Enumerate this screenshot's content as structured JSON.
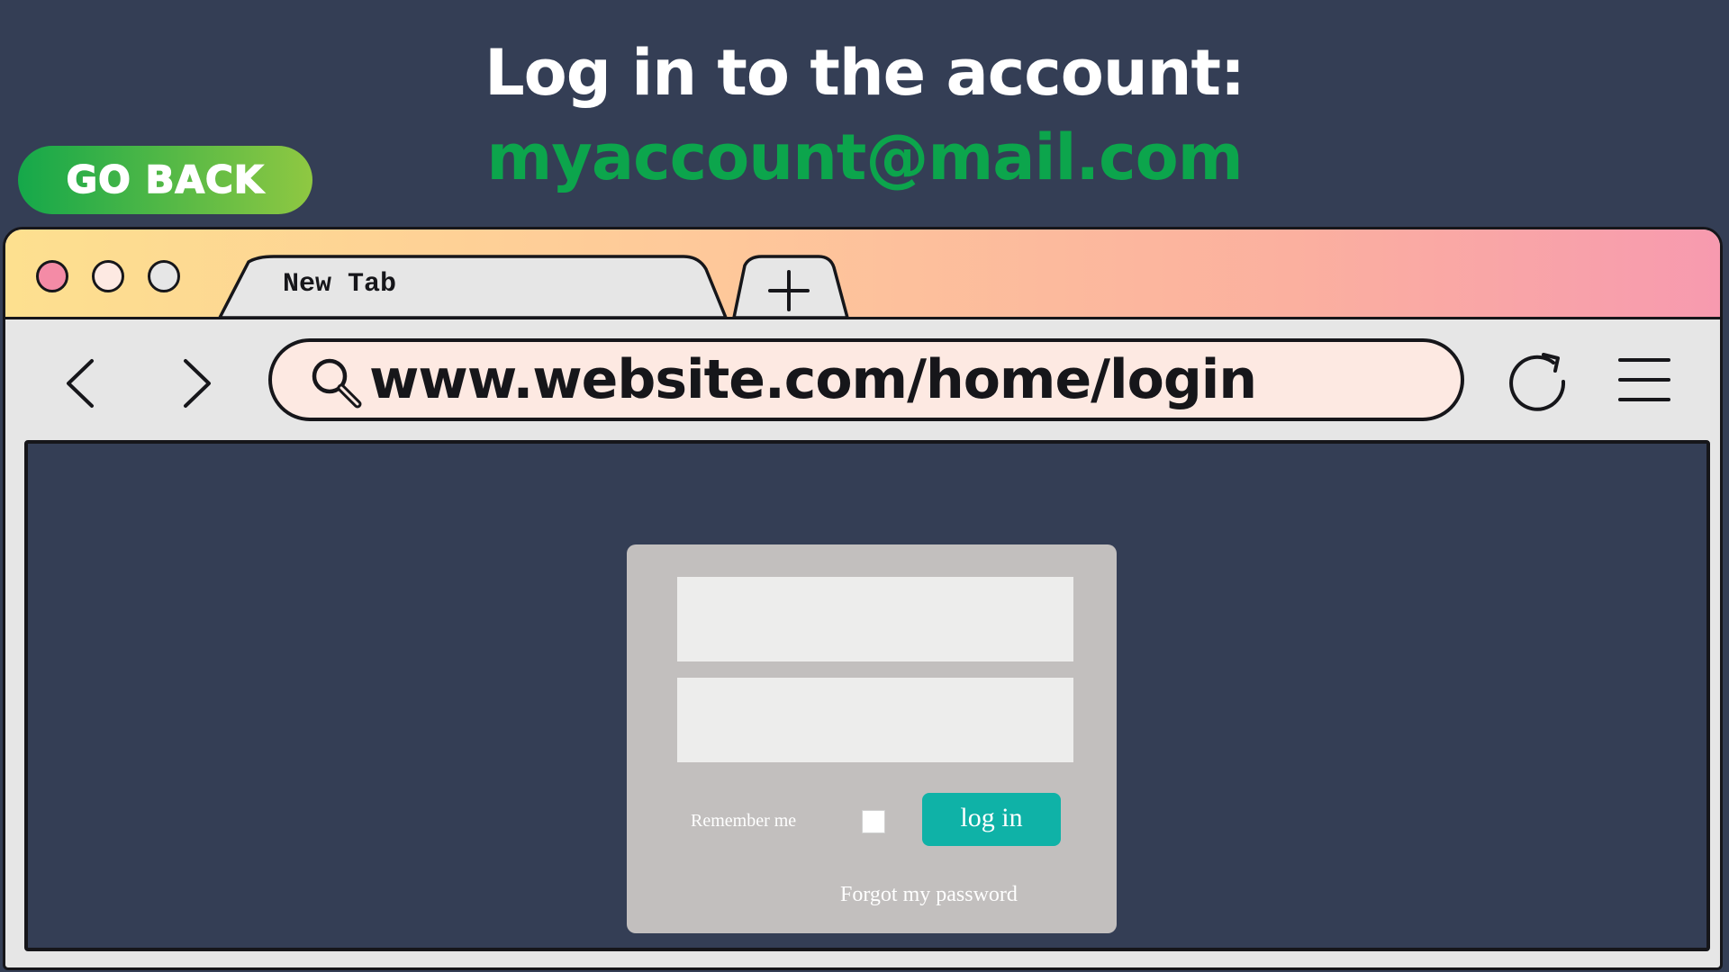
{
  "header": {
    "instruction": "Log in to the account:",
    "account_email": "myaccount@mail.com",
    "go_back_label": "GO BACK"
  },
  "browser": {
    "window_controls": [
      "close",
      "minimize",
      "maximize"
    ],
    "tab": {
      "label": "New Tab"
    },
    "new_tab_icon": "plus-icon",
    "url": "www.website.com/home/login",
    "icons": {
      "back": "chevron-left-icon",
      "forward": "chevron-right-icon",
      "search": "search-icon",
      "reload": "reload-icon",
      "menu": "hamburger-menu-icon"
    }
  },
  "login_form": {
    "username_value": "",
    "password_value": "",
    "remember_label": "Remember me",
    "remember_checked": false,
    "login_button": "log in",
    "forgot_link": "Forgot my password"
  },
  "colors": {
    "page_background": "#343e55",
    "account_email": "#0ca54c",
    "go_back_gradient_start": "#15a84a",
    "go_back_gradient_end": "#8fc842",
    "titlebar_gradient_start": "#fde08f",
    "titlebar_gradient_end": "#f79aaf",
    "close_dot": "#f48ba6",
    "minimize_dot": "#fde9e2",
    "maximize_dot": "#e6e6e6",
    "login_button": "#0fb2a7",
    "card_background": "#c2bfbe"
  }
}
